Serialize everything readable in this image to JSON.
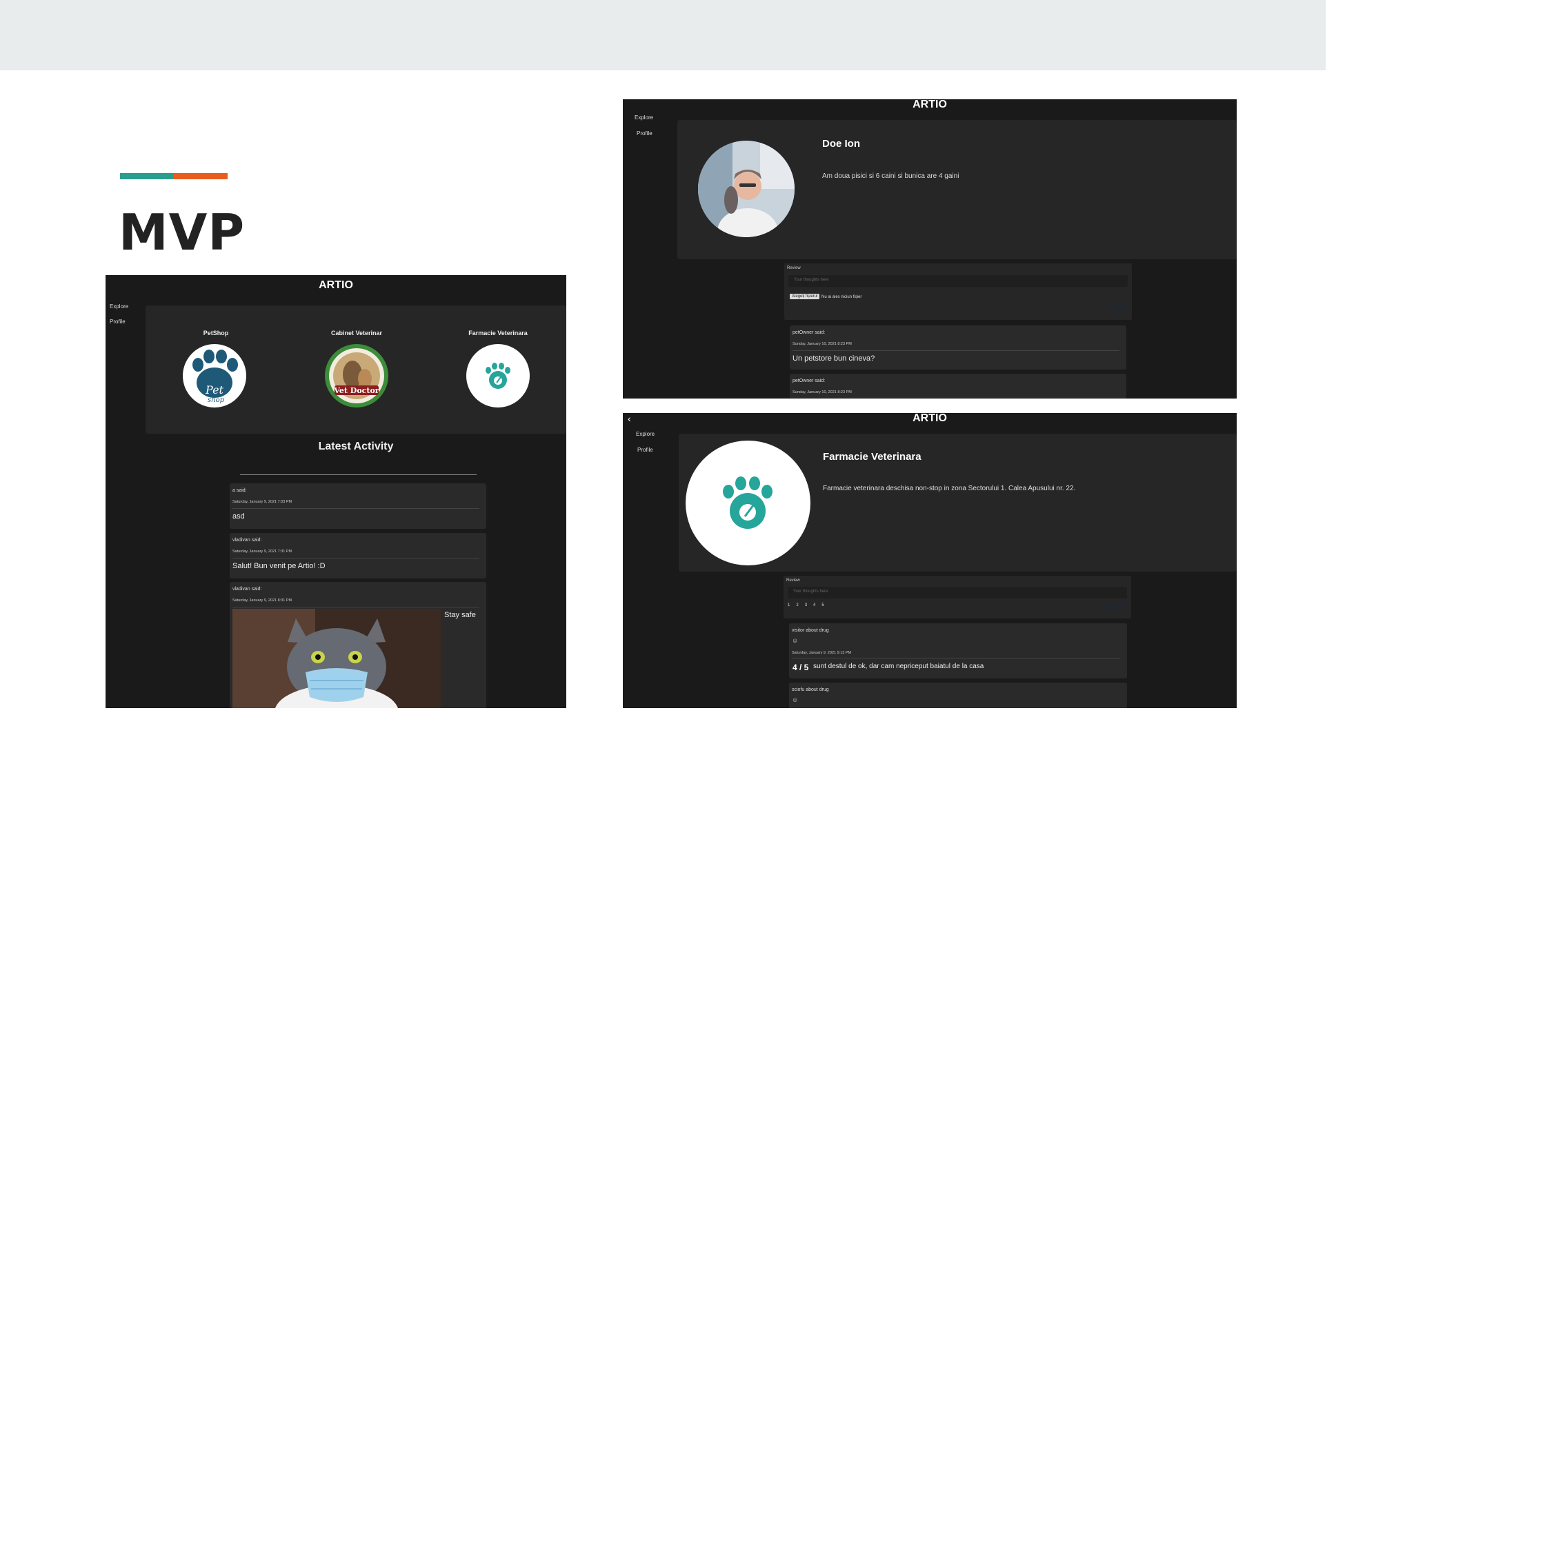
{
  "slide": {
    "title": "MVP",
    "accent_colors": [
      "#2a9d8f",
      "#e85d1c"
    ]
  },
  "explore_screen": {
    "brand": "ARTIO",
    "nav": [
      "Explore",
      "Profile"
    ],
    "categories": [
      {
        "label": "PetShop",
        "icon": "petshop-logo"
      },
      {
        "label": "Cabinet Veterinar",
        "icon": "vet-doctor-logo"
      },
      {
        "label": "Farmacie Veterinara",
        "icon": "paw-mortar-logo"
      }
    ],
    "latest_heading": "Latest Activity",
    "posts": [
      {
        "author": "a said:",
        "date": "Saturday, January 9, 2021 7:03 PM",
        "body": "asd"
      },
      {
        "author": "vladivan said:",
        "date": "Saturday, January 9, 2021 7:31 PM",
        "body": "Salut! Bun venit pe Artio! :D"
      },
      {
        "author": "vladivan said:",
        "date": "Saturday, January 9, 2021 8:31 PM",
        "body": "Stay safe"
      }
    ]
  },
  "profile_screen": {
    "brand": "ARTIO",
    "nav": [
      "Explore",
      "Profile"
    ],
    "name": "Doe Ion",
    "bio": "Am doua pisici si 6 caini si bunica are 4 gaini",
    "review_label": "Review",
    "review_placeholder": "Your thoughts here",
    "file_button": "Alegeți fișierul",
    "file_status": "Nu ai ales niciun fișier",
    "posts": [
      {
        "author": "petOwner said:",
        "date": "Sunday, January 10, 2021 8:23 PM",
        "body": "Un petstore bun cineva?"
      },
      {
        "author": "petOwner said:",
        "date": "Sunday, January 10, 2021 8:23 PM",
        "body": ""
      }
    ]
  },
  "shop_screen": {
    "brand": "ARTIO",
    "back_icon": "chevron-left-icon",
    "nav": [
      "Explore",
      "Profile"
    ],
    "name": "Farmacie Veterinara",
    "description": "Farmacie veterinara deschisa non-stop in zona Sectorului 1. Calea Apusului nr. 22.",
    "review_label": "Review",
    "review_placeholder": "Your thoughts here",
    "rating_options": [
      "1",
      "2",
      "3",
      "4",
      "5"
    ],
    "reviews": [
      {
        "author": "visitor about drug",
        "date": "Saturday, January 9, 2021 9:13 PM",
        "score": "4 / 5",
        "body": "sunt destul de ok, dar cam nepriceput baiatul de la casa"
      },
      {
        "author": "sciofu about drug",
        "date": "",
        "score": "",
        "body": ""
      }
    ]
  }
}
